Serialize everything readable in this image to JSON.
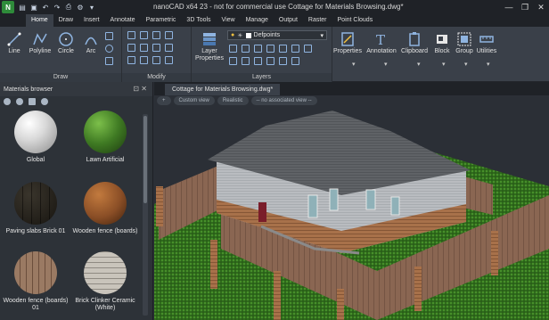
{
  "app": {
    "title": "nanoCAD x64 23 - not for commercial use Cottage for Materials Browsing.dwg*",
    "logo_letter": "N",
    "window_buttons": [
      "—",
      "❐",
      "✕"
    ],
    "qat_icons": [
      "folder-icon",
      "save-icon",
      "undo-icon",
      "redo-icon",
      "print-icon",
      "settings-icon",
      "dropdown-icon"
    ]
  },
  "menu": {
    "tabs": [
      "Home",
      "Draw",
      "Insert",
      "Annotate",
      "Parametric",
      "3D Tools",
      "View",
      "Manage",
      "Output",
      "Raster",
      "Point Clouds"
    ],
    "active": "Home"
  },
  "ribbon": {
    "draw": {
      "label": "Draw",
      "tools": [
        "Line",
        "Polyline",
        "Circle",
        "Arc"
      ]
    },
    "modify": {
      "label": "Modify"
    },
    "layers": {
      "label": "Layers",
      "layer_properties": "Layer Properties",
      "current_layer": "Defpoints"
    },
    "groups": [
      "Properties",
      "Annotation",
      "Clipboard",
      "Block",
      "Group",
      "Utilities"
    ]
  },
  "materials_browser": {
    "title": "Materials browser",
    "items": [
      {
        "name": "Global",
        "color": "#d9d9d9"
      },
      {
        "name": "Lawn Artificial",
        "color": "#3f7a23"
      },
      {
        "name": "Paving slabs Brick 01",
        "color": "#5a554c"
      },
      {
        "name": "Wooden fence (boards)",
        "color": "#8a4e26"
      },
      {
        "name": "Wooden fence (boards) 01",
        "color": "#8b6a55"
      },
      {
        "name": "Brick Clinker Ceramic (White)",
        "color": "#b9b4ac"
      }
    ]
  },
  "document": {
    "tab": "Cottage for Materials Browsing.dwg*",
    "view_chips": [
      "+",
      "Custom view",
      "Realistic",
      "-- no associated view --"
    ]
  },
  "colors": {
    "accent": "#4a90d9",
    "background": "#2b2f36",
    "ribbon": "#3a4049"
  }
}
